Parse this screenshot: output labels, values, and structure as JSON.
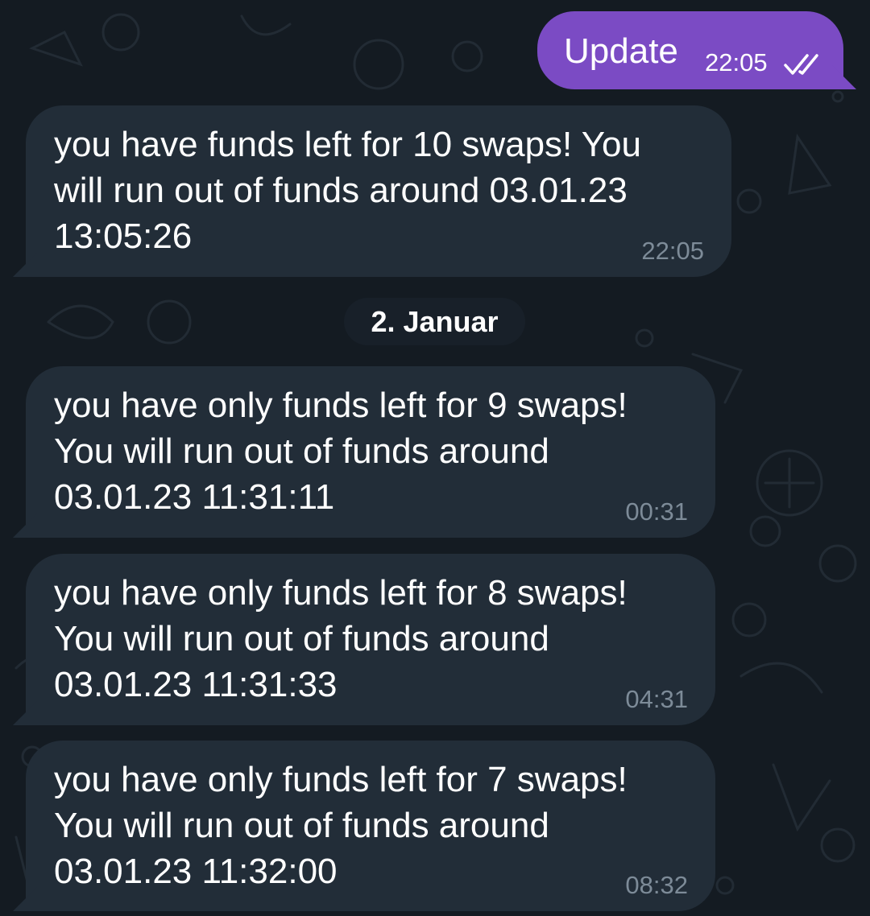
{
  "outgoing": {
    "text": "Update",
    "time": "22:05",
    "status_icon": "double-check-icon"
  },
  "messages": [
    {
      "lines": [
        "you have funds left for 10 swaps! You",
        "will run out of funds around 03.01.23",
        "13:05:26"
      ],
      "time": "22:05"
    },
    {
      "lines": [
        "you have only funds left for 9 swaps!",
        "You will run out of funds around",
        "03.01.23 11:31:11"
      ],
      "time": "00:31"
    },
    {
      "lines": [
        "you have only funds left for 8 swaps!",
        "You will run out of funds around",
        "03.01.23 11:31:33"
      ],
      "time": "04:31"
    },
    {
      "lines": [
        "you have only funds left for 7 swaps!",
        "You will run out of funds around",
        "03.01.23 11:32:00"
      ],
      "time": "08:32"
    }
  ],
  "date_separator": "2. Januar",
  "colors": {
    "background": "#141b22",
    "incoming_bubble": "#222d38",
    "outgoing_bubble": "#7b4bc4",
    "timestamp": "#7d8b98",
    "text": "#ffffff"
  }
}
